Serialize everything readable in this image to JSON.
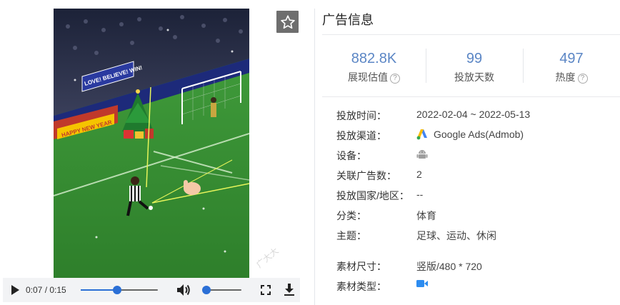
{
  "player": {
    "current_time": "0:07",
    "separator": " / ",
    "duration": "0:15",
    "progress": 0.47,
    "volume": 0.0
  },
  "video_frame": {
    "banner_left": "HAPPY NEW YEAR",
    "banner_mid": "LOVE! BELIEVE! WIN!",
    "watermark": "广大大"
  },
  "info": {
    "title": "广告信息",
    "stats": [
      {
        "value": "882.8K",
        "label": "展现估值",
        "has_help": true
      },
      {
        "value": "99",
        "label": "投放天数",
        "has_help": false
      },
      {
        "value": "497",
        "label": "热度",
        "has_help": true
      }
    ],
    "help_glyph": "?",
    "rows": {
      "period": {
        "label": "投放时间：",
        "value": "2022-02-04 ~ 2022-05-13"
      },
      "channel": {
        "label": "投放渠道：",
        "value": "Google Ads(Admob)"
      },
      "device": {
        "label": "设备："
      },
      "related": {
        "label": "关联广告数：",
        "value": "2"
      },
      "region": {
        "label": "投放国家/地区：",
        "value": "--"
      },
      "category": {
        "label": "分类：",
        "value": "体育"
      },
      "theme": {
        "label": "主题：",
        "value": "足球、运动、休闲"
      },
      "size": {
        "label": "素材尺寸：",
        "value": "竖版/480 * 720"
      },
      "type": {
        "label": "素材类型："
      }
    }
  },
  "colors": {
    "accent": "#2b6fd6",
    "stat_value": "#5b86c5",
    "video_icon": "#2d8cf0",
    "android": "#9e9e9e"
  },
  "icons": {
    "favorite": "star-outline-icon",
    "play": "play-icon",
    "volume": "volume-icon",
    "fullscreen": "fullscreen-icon",
    "download": "download-icon",
    "channel": "google-ads-icon",
    "device": "android-icon",
    "material": "video-camera-icon"
  }
}
